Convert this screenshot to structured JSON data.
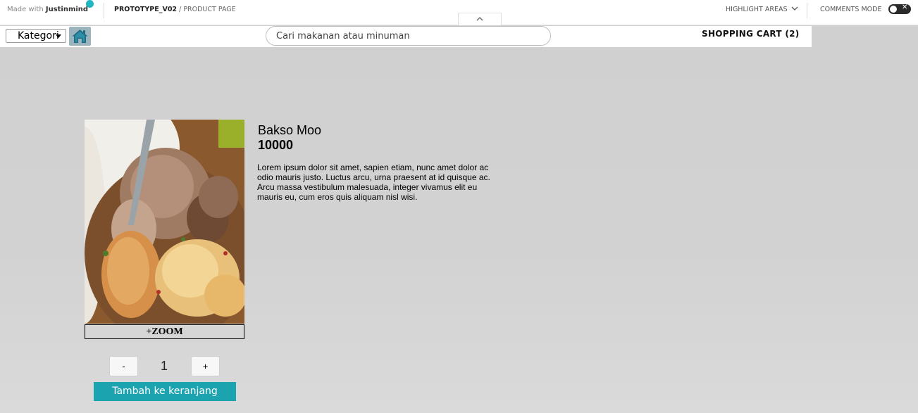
{
  "jm_bar": {
    "made_with": "Made with",
    "brand": "Justinmind",
    "project": "PROTOTYPE_V02",
    "separator": "/",
    "page": "PRODUCT PAGE",
    "highlight_areas": "HIGHLIGHT AREAS",
    "comments_mode": "COMMENTS MODE",
    "accent_color": "#1fb5c1"
  },
  "header": {
    "category_label": "Kategori",
    "home_icon": "home-icon",
    "search_placeholder": "Cari makanan atau minuman",
    "cart_label": "SHOPPING CART (2)"
  },
  "product": {
    "name": "Bakso Moo",
    "price": "10000",
    "description": "Lorem ipsum dolor sit amet, sapien etiam, nunc amet dolor ac odio mauris justo. Luctus arcu, urna praesent at id quisque ac. Arcu massa vestibulum malesuada, integer vivamus elit eu mauris eu, cum eros quis aliquam nisl wisi.",
    "zoom_label": "+ZOOM",
    "decrease_label": "-",
    "quantity": "1",
    "increase_label": "+",
    "add_to_cart_label": "Tambah ke keranjang",
    "button_color": "#1ca3b0"
  }
}
